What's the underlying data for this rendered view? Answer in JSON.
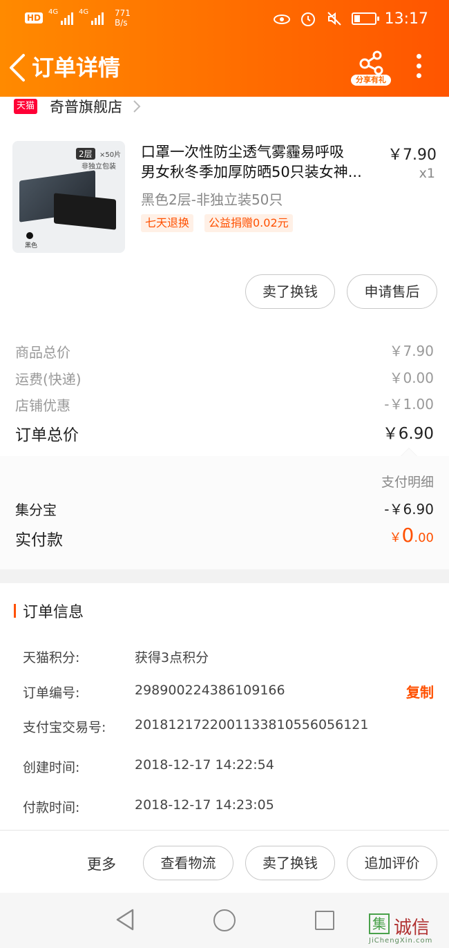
{
  "status_bar": {
    "network1": "4G",
    "network2": "4G",
    "speed_value": "771",
    "speed_unit": "B/s",
    "time": "13:17",
    "hd": "HD"
  },
  "header": {
    "title": "订单详情",
    "share_label": "分享有礼"
  },
  "store": {
    "badge": "天猫",
    "name": "奇普旗舰店"
  },
  "product": {
    "name_line1": "口罩一次性防尘透气雾霾易呼吸",
    "name_line2": "男女秋冬季加厚防晒50只装女神...",
    "price": "￥7.90",
    "qty": "x1",
    "sku": "黑色2层-非独立装50只",
    "tags": [
      "七天退换",
      "公益捐赠0.02元"
    ],
    "thumb": {
      "layers": "2层",
      "count": "×50片",
      "pack": "非独立包装",
      "color": "黑色"
    }
  },
  "item_actions": {
    "sell": "卖了换钱",
    "after_sale": "申请售后"
  },
  "summary": {
    "items": [
      {
        "label": "商品总价",
        "value": "￥7.90"
      },
      {
        "label": "运费(快递)",
        "value": "￥0.00"
      },
      {
        "label": "店铺优惠",
        "value": "-￥1.00"
      }
    ],
    "total_label": "订单总价",
    "total_value": "￥6.90"
  },
  "payment": {
    "detail_label": "支付明细",
    "jifenbao_label": "集分宝",
    "jifenbao_value": "-￥6.90",
    "paid_label": "实付款",
    "paid_currency": "￥",
    "paid_int": "0",
    "paid_dec": ".00"
  },
  "order_info": {
    "title": "订单信息",
    "rows": [
      {
        "key": "天猫积分:",
        "value": "获得3点积分"
      },
      {
        "key": "订单编号:",
        "value": "298900224386109166"
      },
      {
        "key": "支付宝交易号:",
        "value": "2018121722001133810556056121"
      },
      {
        "key": "创建时间:",
        "value": "2018-12-17 14:22:54"
      },
      {
        "key": "付款时间:",
        "value": "2018-12-17 14:23:05"
      }
    ],
    "copy_label": "复制"
  },
  "bottom_actions": {
    "more": "更多",
    "logistics": "查看物流",
    "sell": "卖了换钱",
    "review": "追加评价"
  },
  "watermark": {
    "box": "集",
    "text": "诚信",
    "url": "JiChengXin.com"
  },
  "colors": {
    "accent": "#ff5000",
    "header_start": "#ff8a00",
    "header_end": "#ff5500"
  }
}
